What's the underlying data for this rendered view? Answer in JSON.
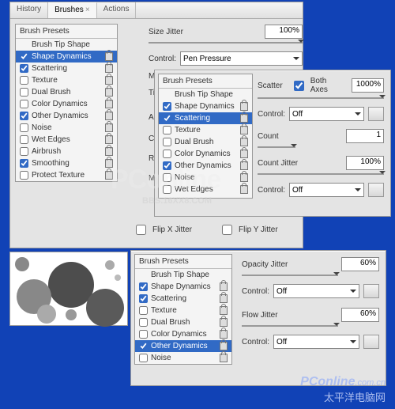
{
  "tabs": {
    "history": "History",
    "brushes": "Brushes",
    "actions": "Actions"
  },
  "boxHeader": "Brush Presets",
  "items": {
    "tip": "Brush Tip Shape",
    "shapeDyn": "Shape Dynamics",
    "scattering": "Scattering",
    "texture": "Texture",
    "dualBrush": "Dual Brush",
    "colorDyn": "Color Dynamics",
    "otherDyn": "Other Dynamics",
    "noise": "Noise",
    "wetEdges": "Wet Edges",
    "airbrush": "Airbrush",
    "smoothing": "Smoothing",
    "protect": "Protect Texture"
  },
  "mainLabels": {
    "sizeJitter": "Size Jitter",
    "control": "Control:",
    "penPressure": "Pen Pressure",
    "minD": "Minimum D",
    "tiltScale": "Tilt Scale",
    "angleJit": "Angle Jitt",
    "controls": "Controls",
    "roundness": "Roundness",
    "minR": "Minimum R",
    "flipX": "Flip X Jitter",
    "flipY": "Flip Y Jitter",
    "pct100": "100%"
  },
  "scatter": {
    "scatter": "Scatter",
    "bothAxes": "Both Axes",
    "pct1000": "1000%",
    "off": "Off",
    "count": "Count",
    "one": "1",
    "countJitter": "Count Jitter",
    "pct100": "100%"
  },
  "other": {
    "opJitter": "Opacity Jitter",
    "flowJitter": "Flow Jitter",
    "off": "Off",
    "pct60": "60%"
  },
  "wm1": "PConline",
  "wm1b": "BBS.16XX8.COM",
  "footerEn": "PConline",
  "footerEn2": ".com.cn",
  "footerCn": "太平洋电脑网"
}
